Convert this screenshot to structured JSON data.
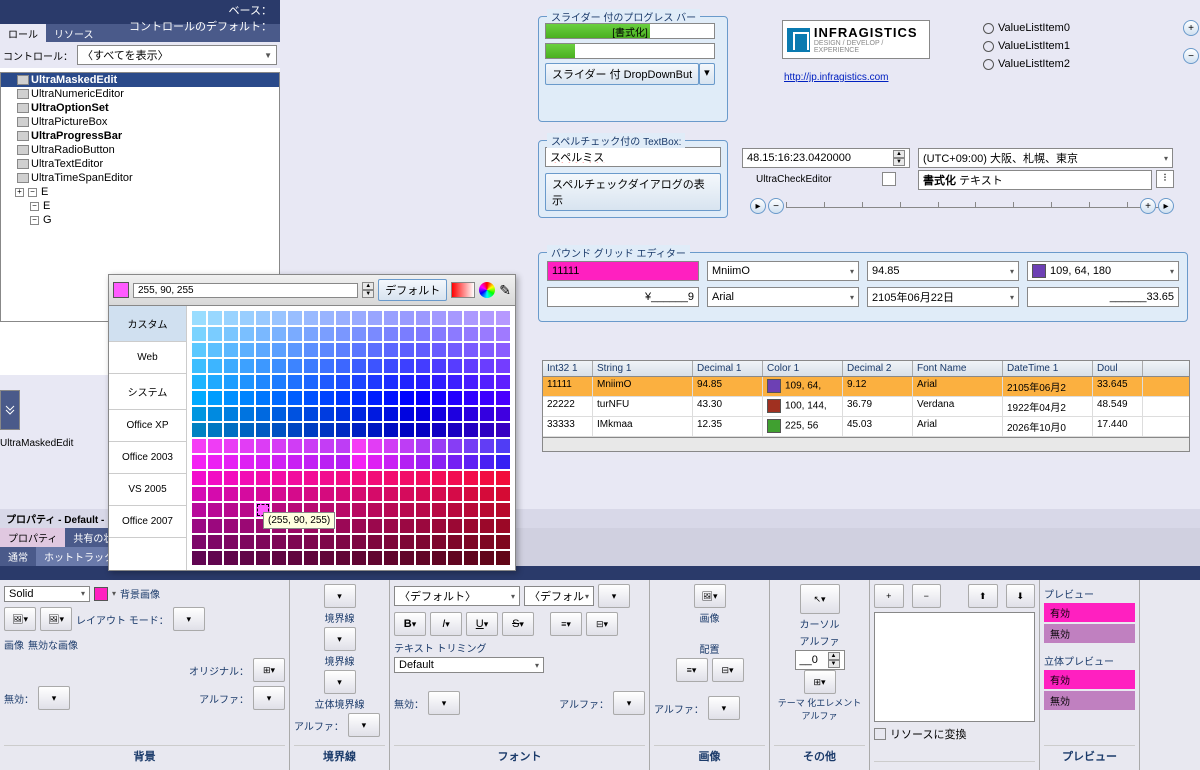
{
  "left": {
    "labels": {
      "base": "ベース：",
      "default": "コントロールのデフォルト："
    },
    "tabs": [
      "ロール",
      "リソース"
    ],
    "control_label": "コントロール：",
    "control_combo": "〈すべてを表示〉",
    "items": [
      {
        "t": "UltraMaskedEdit",
        "b": true,
        "sel": true
      },
      {
        "t": "UltraNumericEditor"
      },
      {
        "t": "UltraOptionSet",
        "b": true
      },
      {
        "t": "UltraPictureBox"
      },
      {
        "t": "UltraProgressBar",
        "b": true
      },
      {
        "t": "UltraRadioButton"
      },
      {
        "t": "UltraTextEditor"
      },
      {
        "t": "UltraTimeSpanEditor"
      }
    ],
    "tree": [
      "E",
      "E",
      "G"
    ],
    "role_selected": "UltraMaskedEdit"
  },
  "slider_box": {
    "title": "スライダー 付のプログレス バー",
    "prog1_label": "[書式化]",
    "btn": "スライダー 付 DropDownBut"
  },
  "spell_box": {
    "title": "スペルチェック付の TextBox:",
    "value": "スペルミス",
    "btn": "スペルチェックダイアログの表示"
  },
  "logo": {
    "brand": "INFRAGISTICS",
    "sub": "DESIGN / DEVELOP / EXPERIENCE",
    "link": "http://jp.infragistics.com"
  },
  "radios": [
    "ValueListItem0",
    "ValueListItem1",
    "ValueListItem2"
  ],
  "time_field": "48.15:16:23.0420000",
  "tz_field": "(UTC+09:00) 大阪、札幌、東京",
  "check_label": "UltraCheckEditor",
  "fmt_label": "書式化",
  "fmt_sub": "テキスト",
  "grid_edit": {
    "title": "バウンド グリッド エディター",
    "r1": {
      "a": "11111",
      "b": "MniimO",
      "c": "94.85",
      "d": "109, 64, 180"
    },
    "r2": {
      "a": "¥______9",
      "b": "Arial",
      "c": "2105年06月22日",
      "d": "______33.65"
    }
  },
  "table": {
    "headers": [
      "Int32 1",
      "String 1",
      "Decimal 1",
      "Color 1",
      "Decimal 2",
      "Font Name",
      "DateTime 1",
      "Doul"
    ],
    "rows": [
      {
        "sel": true,
        "c": [
          "11111",
          "MniimO",
          "94.85",
          "109, 64,",
          "9.12",
          "Arial",
          "2105年06月2",
          "33.645"
        ],
        "color": "#6d40b4"
      },
      {
        "c": [
          "22222",
          "turNFU",
          "43.30",
          "100, 144,",
          "36.79",
          "Verdana",
          "1922年04月2",
          "48.549"
        ],
        "color": "#a03020"
      },
      {
        "c": [
          "33333",
          "IMkmaa",
          "12.35",
          "225, 56",
          "45.03",
          "Arial",
          "2026年10月0",
          "17.440"
        ],
        "color": "#40a030"
      }
    ]
  },
  "picker": {
    "value": "255, 90, 255",
    "default_btn": "デフォルト",
    "tabs": [
      "カスタム",
      "Web",
      "システム",
      "Office XP",
      "Office 2003",
      "VS 2005",
      "Office 2007"
    ],
    "tooltip": "(255, 90, 255)"
  },
  "props": {
    "title": "プロパティ - Default -",
    "tabs": [
      "プロパティ",
      "共有の状"
    ],
    "subtabs": [
      "通常",
      "ホットトラック"
    ],
    "sections": {
      "bg": {
        "foot": "背景",
        "combo": "Solid",
        "l1": "背景画像",
        "l2": "レイアウト モード：",
        "l3": "無効な画像",
        "l4": "画像",
        "l5": "オリジナル：",
        "l6": "無効：",
        "l7": "アルファ："
      },
      "border": {
        "foot": "境界線",
        "l1": "境界線",
        "l2": "境界線",
        "l3": "立体境界線",
        "l4": "アルファ："
      },
      "font": {
        "foot": "フォント",
        "combo1": "〈デフォルト〉",
        "combo2": "〈デフォル",
        "l1": "テキスト トリミング",
        "combo3": "Default",
        "l2": "無効：",
        "l3": "アルファ："
      },
      "img": {
        "foot": "画像",
        "l1": "画像",
        "l2": "配置",
        "l3": "アルファ："
      },
      "other": {
        "foot": "その他",
        "l1": "カーソル",
        "l2": "アルファ",
        "l3": "テーマ 化エレメント アルファ",
        "val": "__0"
      },
      "res": {
        "label": "リソースに変換"
      },
      "preview": {
        "foot": "プレビュー",
        "l1": "プレビュー",
        "l2": "立体プレビュー",
        "valid": "有効",
        "invalid": "無効"
      }
    }
  },
  "chart_data": null
}
